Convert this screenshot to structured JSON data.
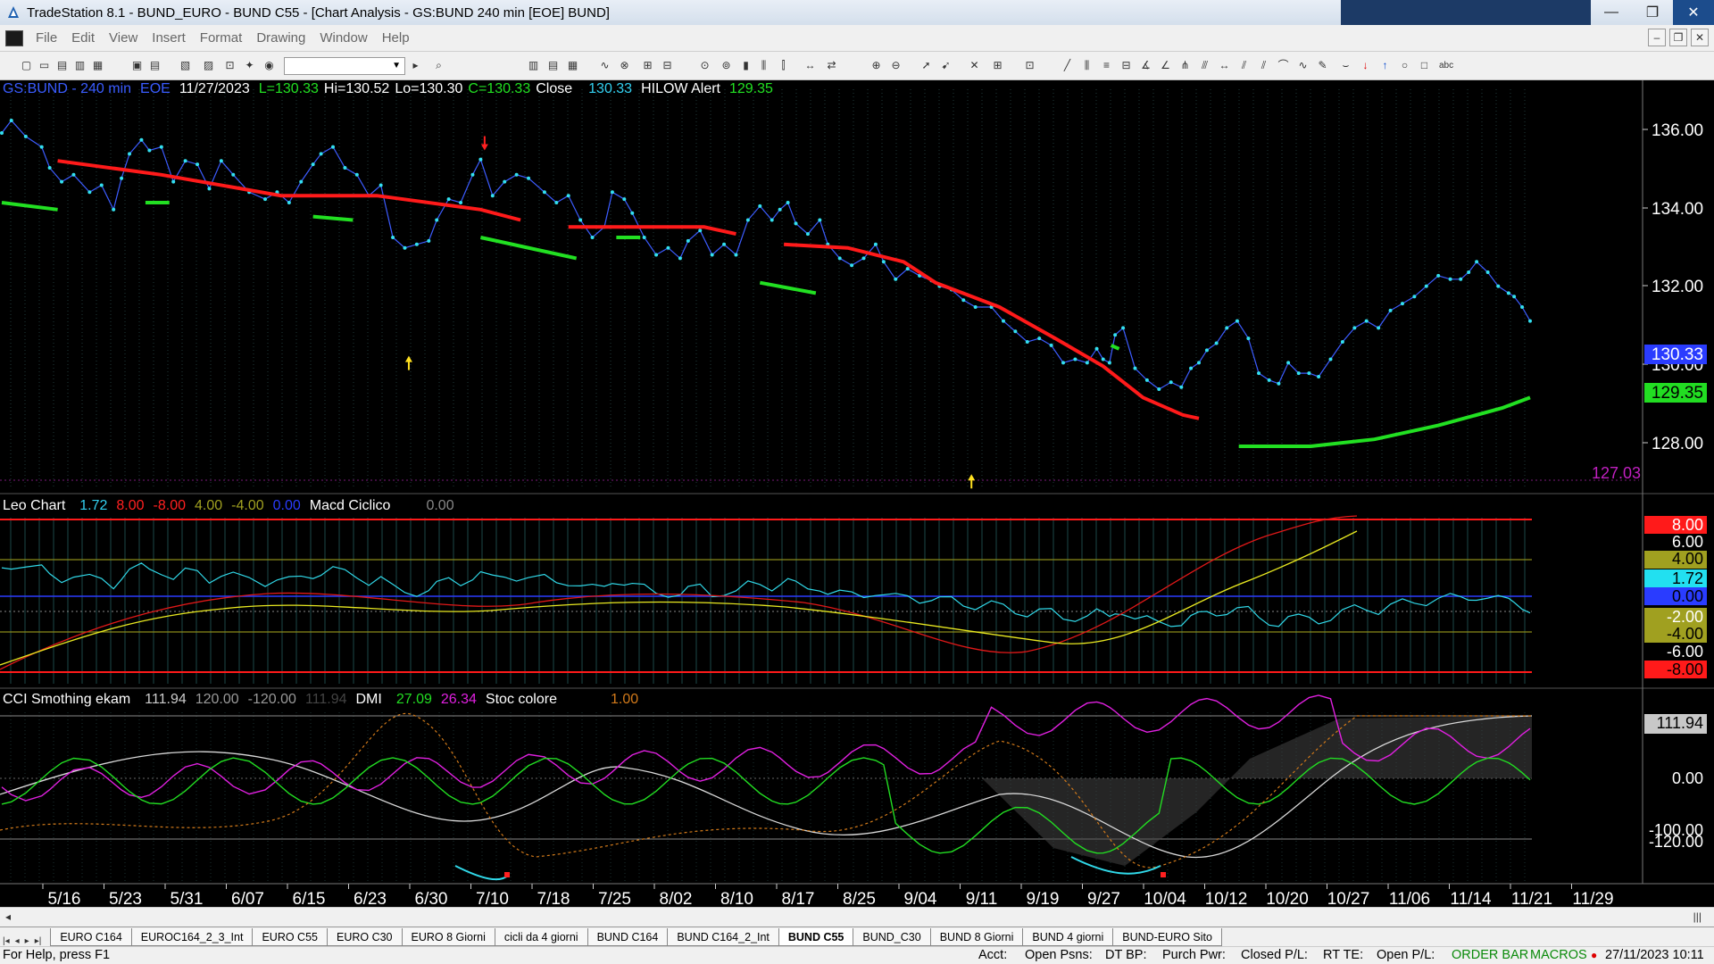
{
  "window": {
    "title": "TradeStation 8.1 - BUND_EURO - BUND C55 - [Chart Analysis - GS:BUND  240 min  [EOE] BUND]",
    "buttons": {
      "minimize": "—",
      "maximize": "❐",
      "close": "✕"
    }
  },
  "menu": {
    "items": [
      "File",
      "Edit",
      "View",
      "Insert",
      "Format",
      "Drawing",
      "Window",
      "Help"
    ],
    "mdi": {
      "minimize": "–",
      "restore": "❐",
      "close": "✕"
    }
  },
  "legend_main": {
    "symbol": "GS:BUND - 240 min",
    "session": "EOE",
    "date": "11/27/2023",
    "last": "L=130.33",
    "high": "Hi=130.52",
    "low": "Lo=130.30",
    "close_val": "C=130.33",
    "close_label": "Close",
    "close_num": "130.33",
    "hilow_label": "HILOW Alert",
    "hilow_num": "129.35"
  },
  "legend_leo": {
    "name": "Leo Chart",
    "v1": "1.72",
    "v2": "8.00",
    "v3": "-8.00",
    "v4": "4.00",
    "v5": "-4.00",
    "v6": "0.00",
    "macd_name": "Macd Ciclico",
    "macd_val": "0.00"
  },
  "legend_cci": {
    "name": "CCI Smothing ekam",
    "v1": "111.94",
    "v2": "120.00",
    "v3": "-120.00",
    "v4": "111.94",
    "dmi_name": "DMI",
    "dmi1": "27.09",
    "dmi2": "26.34",
    "stoc_name": "Stoc colore",
    "stoc_val": "1.00"
  },
  "price_axis": {
    "ticks": [
      "136.00",
      "134.00",
      "132.00",
      "130.00",
      "128.00"
    ],
    "last_price": "130.33",
    "alert_price": "129.35",
    "low_marker": "127.03"
  },
  "leo_axis": {
    "ticks": [
      "8.00",
      "6.00",
      "4.00",
      "1.72",
      "0.00",
      "-2.00",
      "-4.00",
      "-6.00",
      "-8.00"
    ]
  },
  "cci_axis": {
    "ticks": [
      "111.94",
      "0.00",
      "-100.00",
      "-120.00"
    ]
  },
  "date_axis": [
    "5/16",
    "5/23",
    "5/31",
    "6/07",
    "6/15",
    "6/23",
    "6/30",
    "7/10",
    "7/18",
    "7/25",
    "8/02",
    "8/10",
    "8/17",
    "8/25",
    "9/04",
    "9/11",
    "9/19",
    "9/27",
    "10/04",
    "10/12",
    "10/20",
    "10/27",
    "11/06",
    "11/14",
    "11/21",
    "11/29"
  ],
  "tabs": {
    "items": [
      "EURO C164",
      "EUROC164_2_3_Int",
      "EURO C55",
      "EURO C30",
      "EURO 8 Giorni",
      "cicli da 4 giorni",
      "BUND C164",
      "BUND C164_2_Int",
      "BUND C55",
      "BUND_C30",
      "BUND 8 Giorni",
      "BUND 4 giorni",
      "BUND-EURO Sito"
    ],
    "active": "BUND C55"
  },
  "status": {
    "help": "For Help, press F1",
    "acct": "Acct:",
    "open_psns": "Open Psns:",
    "dt_bp": "DT BP:",
    "purch_pwr": "Purch Pwr:",
    "closed_pl": "Closed P/L:",
    "rt_te": "RT TE:",
    "open_pl": "Open P/L:",
    "order_bar": "ORDER BAR",
    "macros": "MACROS",
    "datetime": "27/11/2023 10:11"
  },
  "colors": {
    "price_line": "#3c5cff",
    "price_dots": "#33e0f0",
    "ma_red": "#ff1a1a",
    "ma_green": "#22e022",
    "axis_bg": "#000000",
    "cci_white": "#d8d8d8",
    "cci_magenta": "#e020e0",
    "dmi_green": "#22dd22",
    "stoc_orange": "#d27a1a",
    "yellow": "#e8e820"
  }
}
